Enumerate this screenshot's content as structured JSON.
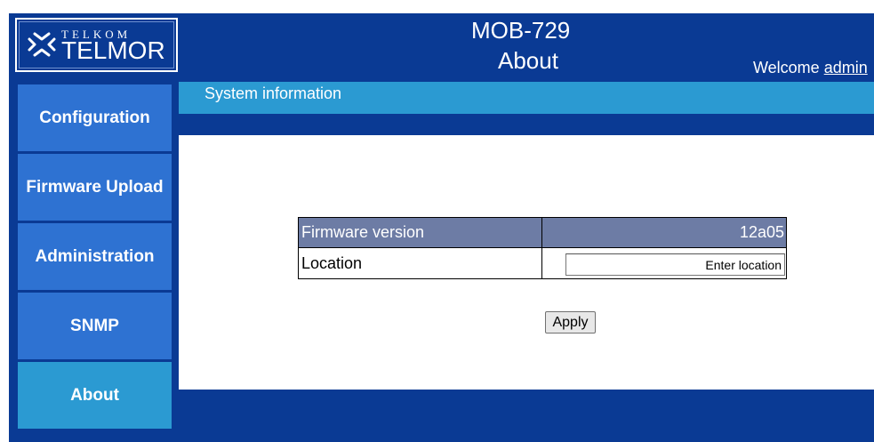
{
  "header": {
    "logo_small_text": "TELKOM",
    "logo_big_text": "TELMOR",
    "model": "MOB-729",
    "page_title": "About",
    "welcome_prefix": "Welcome ",
    "username": "admin"
  },
  "sidebar": {
    "items": [
      {
        "label": "Configuration"
      },
      {
        "label": "Firmware Upload"
      },
      {
        "label": "Administration"
      },
      {
        "label": "SNMP"
      },
      {
        "label": "About",
        "active": true
      }
    ]
  },
  "main": {
    "section_title": "System information",
    "firmware_label": "Firmware version",
    "firmware_value": "12a05",
    "location_label": "Location",
    "location_placeholder": "Enter location",
    "apply_label": "Apply"
  },
  "colors": {
    "background_navy": "#0a3a94",
    "nav_blue": "#2e72d2",
    "active_teal": "#2b9ad2",
    "table_header": "#6d7ca5"
  }
}
